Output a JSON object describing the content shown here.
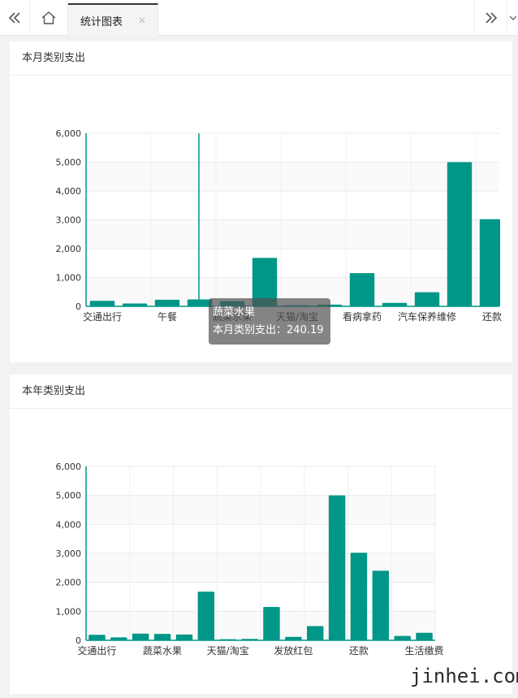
{
  "tabs": {
    "active_label": "统计图表",
    "close_glyph": "×"
  },
  "icons": {
    "left": "double-chevron-left-icon",
    "home": "home-icon",
    "right": "double-chevron-right-icon"
  },
  "watermark": "jinhei.com",
  "charts": [
    {
      "card_title": "本月类别支出",
      "tooltip": {
        "category": "蔬菜水果",
        "series": "本月类别支出",
        "value": "240.19"
      }
    },
    {
      "card_title": "本年类别支出"
    }
  ],
  "chart_data": [
    {
      "type": "bar",
      "title": "本月类别支出",
      "categories": [
        "交通出行",
        "",
        "午餐",
        "",
        "蔬菜水果",
        "",
        "天猫/淘宝",
        "",
        "看病拿药",
        "",
        "汽车保养维修",
        "",
        "还款"
      ],
      "series": [
        {
          "name": "本月类别支出",
          "values": [
            190,
            100,
            230,
            240.19,
            180,
            1680,
            40,
            60,
            1150,
            120,
            490,
            5000,
            3020
          ]
        }
      ],
      "tick_labels": [
        "交通出行",
        "午餐",
        "蔬菜水果",
        "天猫/淘宝",
        "看病拿药",
        "汽车保养维修",
        "还款"
      ],
      "ylim": [
        0,
        6000
      ],
      "yticks": [
        "0",
        "1,000",
        "2,000",
        "3,000",
        "4,000",
        "5,000",
        "6,000"
      ],
      "color": "#009688",
      "grid": true
    },
    {
      "type": "bar",
      "title": "本年类别支出",
      "categories": [
        "交通出行",
        "",
        "",
        "蔬菜水果",
        "",
        "",
        "天猫/淘宝",
        "",
        "",
        "发放红包",
        "",
        "",
        "还款",
        "",
        "",
        "生活缴费"
      ],
      "series": [
        {
          "name": "本年类别支出",
          "values": [
            190,
            100,
            230,
            220,
            200,
            1680,
            40,
            50,
            1150,
            120,
            490,
            5000,
            3020,
            2400,
            150,
            260
          ]
        }
      ],
      "tick_labels": [
        "交通出行",
        "蔬菜水果",
        "天猫/淘宝",
        "发放红包",
        "还款",
        "生活缴费"
      ],
      "ylim": [
        0,
        6000
      ],
      "yticks": [
        "0",
        "1,000",
        "2,000",
        "3,000",
        "4,000",
        "5,000",
        "6,000"
      ],
      "color": "#009688",
      "grid": true
    }
  ]
}
